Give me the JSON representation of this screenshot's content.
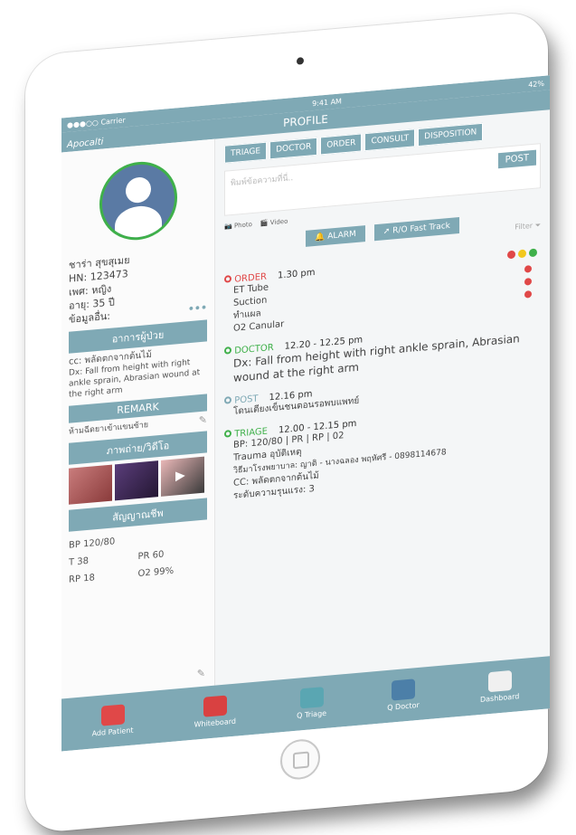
{
  "status": {
    "carrier": "●●●○○ Carrier",
    "time": "9:41 AM",
    "battery": "42%"
  },
  "nav": {
    "title": "PROFILE",
    "brand": "Apocalti"
  },
  "tabs": [
    {
      "label": "TRIAGE"
    },
    {
      "label": "DOCTOR"
    },
    {
      "label": "ORDER"
    },
    {
      "label": "CONSULT"
    },
    {
      "label": "DISPOSITION"
    }
  ],
  "post": {
    "placeholder": "พิมพ์ข้อความที่นี่..",
    "button": "POST",
    "photo": "Photo",
    "video": "Video"
  },
  "actions": {
    "alarm": "ALARM",
    "fasttrack": "R/O Fast Track",
    "filter": "Filter"
  },
  "patient": {
    "name": "ชาร่า สุขสุเมย",
    "hn": "HN: 123473",
    "sex": "เพศ: หญิง",
    "age": "อายุ: 35 ปี",
    "more": "ข้อมูลอื่น:",
    "more_dots": "•••"
  },
  "symptoms": {
    "title": "อาการผู้ป่วย",
    "cc": "cc: พลัดตกจากต้นไม้",
    "dx": "Dx: Fall from height with right ankle sprain, Abrasian wound at the right arm"
  },
  "remark": {
    "title": "REMARK",
    "text": "ห้ามฉีดยาเข้าแขนซ้าย"
  },
  "media": {
    "title": "ภาพถ่าย/วิดีโอ"
  },
  "vitals": {
    "title": "สัญญาณชีพ",
    "bp": "BP 120/80",
    "t": "T 38",
    "pr": "PR 60",
    "rp": "RP 18",
    "o2": "O2 99%"
  },
  "feed": {
    "order": {
      "label": "ORDER",
      "time": "1.30 pm",
      "items": [
        "ET Tube",
        "Suction",
        "ทำแผล",
        "O2 Canular"
      ]
    },
    "doctor": {
      "label": "DOCTOR",
      "time": "12.20 - 12.25 pm",
      "text": "Dx: Fall from height with right ankle sprain, Abrasian wound at the right arm"
    },
    "post": {
      "label": "POST",
      "time": "12.16 pm",
      "text": "โดนเตียงเข็นชนตอนรอพบแพทย์"
    },
    "triage": {
      "label": "TRIAGE",
      "time": "12.00 - 12.15 pm",
      "lines": [
        "BP: 120/80 | PR | RP | 02",
        "Trauma อุบัติเหตุ",
        "วิธีมาโรงพยาบาล: ญาติ - นางฉลอง พฤหัศรี - 0898114678",
        "CC: พลัดตกจากต้นไม้",
        "ระดับความรุนแรง: 3"
      ]
    }
  },
  "colors": {
    "primary": "#7fa9b5",
    "order": "#e04848",
    "doctor": "#3fb04a",
    "post": "#7fa9b5",
    "triage": "#3fb04a",
    "tl_red": "#e04848",
    "tl_yellow": "#f2c81e",
    "tl_green": "#3fb04a"
  },
  "bottom": [
    {
      "label": "Add Patient"
    },
    {
      "label": "Whiteboard"
    },
    {
      "label": "Q Triage"
    },
    {
      "label": "Q Doctor"
    },
    {
      "label": "Dashboard"
    }
  ]
}
